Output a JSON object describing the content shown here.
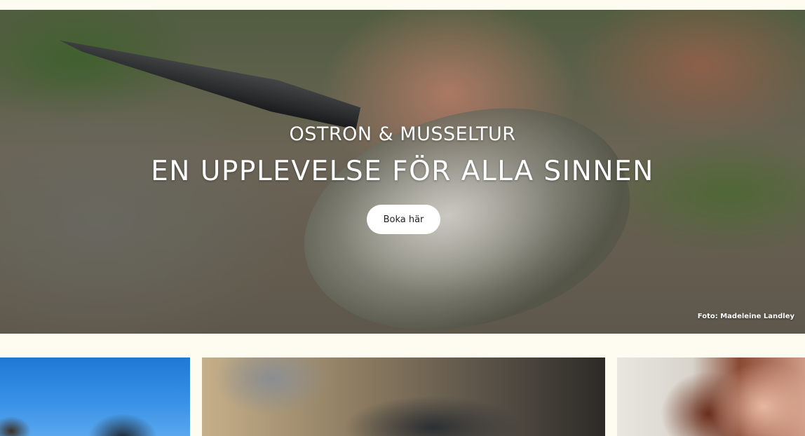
{
  "hero": {
    "subtitle": "OSTRON & MUSSELTUR",
    "title": "EN UPPLEVELSE FÖR ALLA SINNEN",
    "button_label": "Boka här",
    "photo_credit": "Foto: Madeleine Landley"
  },
  "colors": {
    "page_background": "#fefcf1",
    "hero_text": "#ffffff",
    "button_background": "#ffffff"
  }
}
